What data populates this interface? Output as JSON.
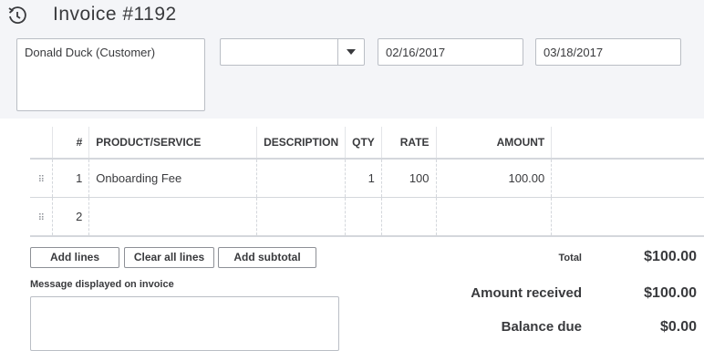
{
  "header": {
    "recent_icon": "recent-transactions-icon",
    "title": "Invoice #1192"
  },
  "customer": {
    "value": "Donald Duck (Customer)"
  },
  "terms": {
    "value": ""
  },
  "dates": {
    "invoice_date": "02/16/2017",
    "due_date": "03/18/2017"
  },
  "table": {
    "columns": [
      "#",
      "PRODUCT/SERVICE",
      "DESCRIPTION",
      "QTY",
      "RATE",
      "AMOUNT"
    ],
    "rows": [
      {
        "num": "1",
        "product": "Onboarding Fee",
        "description": "",
        "qty": "1",
        "rate": "100",
        "amount": "100.00"
      },
      {
        "num": "2",
        "product": "",
        "description": "",
        "qty": "",
        "rate": "",
        "amount": ""
      }
    ]
  },
  "buttons": {
    "add_lines": "Add lines",
    "clear_all": "Clear all lines",
    "add_subtotal": "Add subtotal"
  },
  "message": {
    "label": "Message displayed on invoice",
    "value": ""
  },
  "summary": {
    "total_label": "Total",
    "total_value": "$100.00",
    "received_label": "Amount received",
    "received_value": "$100.00",
    "balance_label": "Balance due",
    "balance_value": "$0.00"
  }
}
